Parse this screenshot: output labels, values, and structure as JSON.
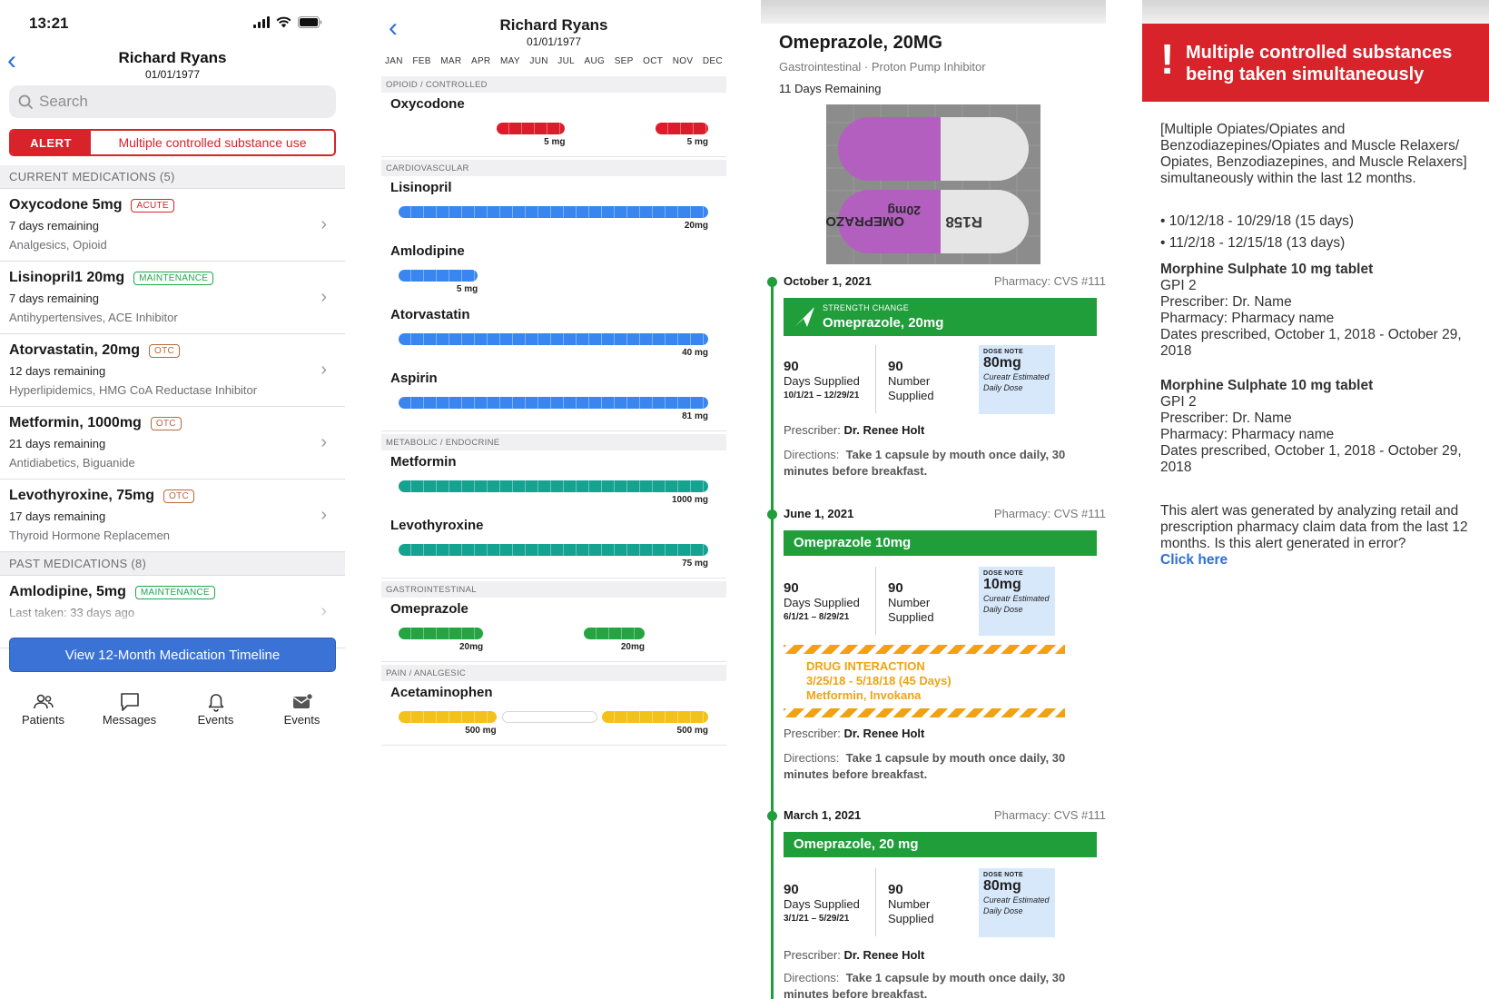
{
  "colors": {
    "alert_red": "#d8232a",
    "ios_blue": "#2e6fd8",
    "button_blue": "#3b72d6",
    "green": "#1f9e3a",
    "cardio_blue": "#3a86f0",
    "metabolic_teal": "#15a391",
    "gastro_green": "#25a442",
    "pain_yellow": "#f2c21a",
    "opioid_red": "#dd1c2b",
    "warning_orange": "#f0a312"
  },
  "panel1": {
    "status_time": "13:21",
    "patient_name": "Richard Ryans",
    "patient_dob": "01/01/1977",
    "search_placeholder": "Search",
    "alert_tag": "ALERT",
    "alert_message": "Multiple controlled substance use",
    "current_header": "CURRENT MEDICATIONS (5)",
    "current_meds": [
      {
        "name": "Oxycodone 5mg",
        "badge": "ACUTE",
        "badge_type": "acute",
        "remaining": "7 days remaining",
        "category": "Analgesics, Opioid"
      },
      {
        "name": "Lisinopril1 20mg",
        "badge": "MAINTENANCE",
        "badge_type": "maint",
        "remaining": "7 days remaining",
        "category": "Antihypertensives, ACE Inhibitor"
      },
      {
        "name": "Atorvastatin, 20mg",
        "badge": "OTC",
        "badge_type": "otc",
        "remaining": "12 days remaining",
        "category": "Hyperlipidemics, HMG CoA Reductase Inhibitor"
      },
      {
        "name": "Metformin, 1000mg",
        "badge": "OTC",
        "badge_type": "otc",
        "remaining": "21 days remaining",
        "category": "Antidiabetics, Biguanide"
      },
      {
        "name": "Levothyroxine, 75mg",
        "badge": "OTC",
        "badge_type": "otc",
        "remaining": "17 days remaining",
        "category": "Thyroid Hormone Replacemen"
      }
    ],
    "past_header": "PAST MEDICATIONS (8)",
    "past_meds": [
      {
        "name": "Amlodipine, 5mg",
        "badge": "MAINTENANCE",
        "badge_type": "maint",
        "remaining": "Last taken: 33 days ago"
      }
    ],
    "timeline_button": "View 12-Month Medication Timeline",
    "tabs": [
      {
        "label": "Patients",
        "icon": "patients-icon"
      },
      {
        "label": "Messages",
        "icon": "messages-icon"
      },
      {
        "label": "Events",
        "icon": "bell-icon"
      },
      {
        "label": "Events",
        "icon": "envelope-icon"
      }
    ]
  },
  "panel2": {
    "patient_name": "Richard Ryans",
    "patient_dob": "01/01/1977",
    "months": [
      "JAN",
      "FEB",
      "MAR",
      "APR",
      "MAY",
      "JUN",
      "JUL",
      "AUG",
      "SEP",
      "OCT",
      "NOV",
      "DEC"
    ],
    "groups": [
      {
        "label": "OPIOID / CONTROLLED",
        "drugs": [
          {
            "name": "Oxycodone",
            "color": "#dd1c2b",
            "segments": [
              {
                "start_month": 4.0,
                "end_month": 6.6,
                "dose": "5 mg"
              },
              {
                "start_month": 10.0,
                "end_month": 12.0,
                "dose": "5 mg"
              }
            ]
          }
        ]
      },
      {
        "label": "CARDIOVASCULAR",
        "drugs": [
          {
            "name": "Lisinopril",
            "color": "#3a86f0",
            "segments": [
              {
                "start_month": 0.3,
                "end_month": 12.0,
                "dose": "20mg"
              }
            ]
          },
          {
            "name": "Amlodipine",
            "color": "#3a86f0",
            "segments": [
              {
                "start_month": 0.3,
                "end_month": 3.3,
                "dose": "5 mg"
              }
            ]
          },
          {
            "name": "Atorvastatin",
            "color": "#3a86f0",
            "segments": [
              {
                "start_month": 0.3,
                "end_month": 12.0,
                "dose": "40 mg"
              }
            ]
          },
          {
            "name": "Aspirin",
            "color": "#3a86f0",
            "segments": [
              {
                "start_month": 0.3,
                "end_month": 12.0,
                "dose": "81 mg"
              }
            ]
          }
        ]
      },
      {
        "label": "METABOLIC / ENDOCRINE",
        "drugs": [
          {
            "name": "Metformin",
            "color": "#15a391",
            "segments": [
              {
                "start_month": 0.3,
                "end_month": 12.0,
                "dose": "1000 mg"
              }
            ]
          },
          {
            "name": "Levothyroxine",
            "color": "#15a391",
            "segments": [
              {
                "start_month": 0.3,
                "end_month": 12.0,
                "dose": "75 mg"
              }
            ]
          }
        ]
      },
      {
        "label": "GASTROINTESTINAL",
        "drugs": [
          {
            "name": "Omeprazole",
            "color": "#25a442",
            "segments": [
              {
                "start_month": 0.3,
                "end_month": 3.5,
                "dose": "20mg"
              },
              {
                "start_month": 7.3,
                "end_month": 9.6,
                "dose": "20mg"
              }
            ]
          }
        ]
      },
      {
        "label": "PAIN / ANALGESIC",
        "drugs": [
          {
            "name": "Acetaminophen",
            "color": "#f2c21a",
            "segments": [
              {
                "start_month": 0.3,
                "end_month": 4.0,
                "dose": "500 mg"
              },
              {
                "start_month": 4.2,
                "end_month": 7.8,
                "dose": "",
                "empty": true
              },
              {
                "start_month": 8.0,
                "end_month": 12.0,
                "dose": "500 mg"
              }
            ]
          }
        ]
      }
    ]
  },
  "panel3": {
    "drug_title": "Omeprazole, 20MG",
    "drug_class": "Gastrointestinal · Proton Pump Inhibitor",
    "remaining": "11 Days Remaining",
    "pill_imprint_1": "OMEPRAZOLE",
    "pill_imprint_2": "20mg",
    "pill_imprint_3": "R158",
    "entries": [
      {
        "date": "October 1, 2021",
        "pharmacy": "Pharmacy: CVS #111",
        "change_label": "STRENGTH CHANGE",
        "bar_title": "Omeprazole, 20mg",
        "days": "90",
        "days_label": "Days Supplied",
        "days_range": "10/1/21 – 12/29/21",
        "number": "90",
        "number_label": "Number Supplied",
        "note_header": "DOSE NOTE",
        "note_value": "80mg",
        "note_sub": "Cureatr Estimated Daily Dose",
        "prescriber_label": "Prescriber:",
        "prescriber": "Dr. Renee Holt",
        "directions_label": "Directions:",
        "directions": "Take 1 capsule by mouth once daily, 30 minutes before breakfast."
      },
      {
        "date": "June 1, 2021",
        "pharmacy": "Pharmacy: CVS #111",
        "bar_title": "Omeprazole 10mg",
        "days": "90",
        "days_label": "Days Supplied",
        "days_range": "6/1/21 – 8/29/21",
        "number": "90",
        "number_label": "Number Supplied",
        "note_header": "DOSE NOTE",
        "note_value": "10mg",
        "note_sub": "Cureatr Estimated Daily Dose",
        "interaction_title": "DRUG INTERACTION",
        "interaction_dates": "3/25/18 - 5/18/18 (45 Days)",
        "interaction_drugs": "Metformin, Invokana",
        "prescriber_label": "Prescriber:",
        "prescriber": "Dr. Renee Holt",
        "directions_label": "Directions:",
        "directions": "Take 1 capsule by mouth once daily, 30 minutes before breakfast."
      },
      {
        "date": "March 1, 2021",
        "pharmacy": "Pharmacy: CVS #111",
        "bar_title": "Omeprazole, 20 mg",
        "days": "90",
        "days_label": "Days Supplied",
        "days_range": "3/1/21 – 5/29/21",
        "number": "90",
        "number_label": "Number Supplied",
        "note_header": "DOSE NOTE",
        "note_value": "80mg",
        "note_sub": "Cureatr Estimated Daily Dose",
        "prescriber_label": "Prescriber:",
        "prescriber": "Dr. Renee Holt",
        "directions_label": "Directions:",
        "directions": "Take 1 capsule by mouth once daily, 30 minutes before breakfast."
      }
    ]
  },
  "panel4": {
    "banner_text": "Multiple controlled substances being taken simultaneously",
    "description": "[Multiple Opiates/Opiates and Benzodiazepines/Opiates and Muscle Relaxers/ Opiates, Benzodiazepines, and Muscle Relaxers] simultaneously within the last 12 months.",
    "periods": [
      "• 10/12/18 - 10/29/18 (15 days)",
      "• 11/2/18 - 12/15/18 (13 days)"
    ],
    "prescriptions": [
      {
        "title": "Morphine Sulphate 10 mg tablet",
        "gpi": "GPI 2",
        "prescriber": "Prescriber: Dr. Name",
        "pharmacy": "Pharmacy: Pharmacy name",
        "dates": "Dates prescribed, October 1, 2018 - October 29, 2018"
      },
      {
        "title": "Morphine Sulphate 10 mg tablet",
        "gpi": "GPI 2",
        "prescriber": "Prescriber: Dr. Name",
        "pharmacy": "Pharmacy: Pharmacy name",
        "dates": "Dates prescribed, October 1, 2018 - October 29, 2018"
      }
    ],
    "footer_text": "This alert was generated by analyzing retail and prescription pharmacy claim data from the last 12 months. Is this alert generated in error?",
    "footer_link": "Click here"
  }
}
